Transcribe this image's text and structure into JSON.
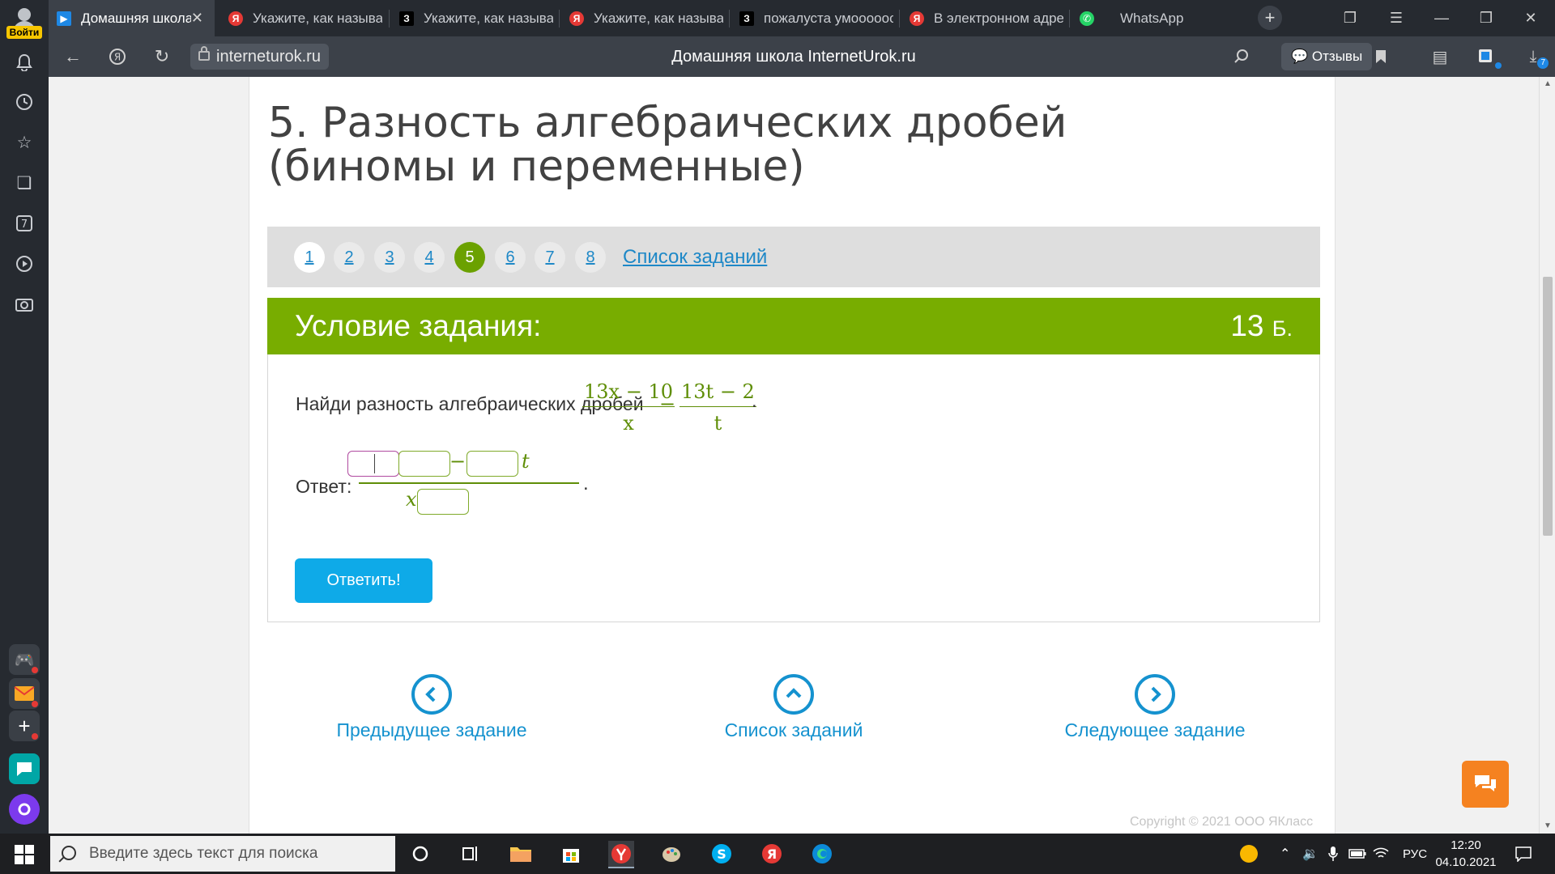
{
  "browser": {
    "tabs": [
      {
        "label": "Домашняя школа",
        "favicon": "home-icon",
        "active": true
      },
      {
        "label": "Укажите, как называ",
        "favicon": "yandex-icon"
      },
      {
        "label": "Укажите, как называ",
        "favicon": "znanija-icon"
      },
      {
        "label": "Укажите, как называ",
        "favicon": "yandex-icon"
      },
      {
        "label": "пожалуста умоооооо",
        "favicon": "znanija-icon"
      },
      {
        "label": "В электронном адре",
        "favicon": "yandex-icon"
      },
      {
        "label": "WhatsApp",
        "favicon": "whatsapp-icon"
      }
    ],
    "url": "interneturok.ru",
    "page_title": "Домашняя школа InternetUrok.ru",
    "reviews_label": "Отзывы",
    "downloads_badge": "7"
  },
  "sidebar": {
    "login_label": "Войти",
    "counter_badge": "7"
  },
  "page": {
    "title": "5. Разность алгебраических дробей (биномы и переменные)",
    "task_numbers": [
      "1",
      "2",
      "3",
      "4",
      "5",
      "6",
      "7",
      "8"
    ],
    "current_task": "5",
    "task_list_link": "Список заданий",
    "condition_title": "Условие задания:",
    "points_value": "13",
    "points_unit": "Б.",
    "question_text": "Найди разность алгебраических дробей",
    "fraction1_num": "13x − 10",
    "fraction1_den": "x",
    "fraction2_num": "13t − 2",
    "fraction2_den": "t",
    "minus_sign": "−",
    "period": ".",
    "answer_label": "Ответ:",
    "answer_num_var": "t",
    "answer_den_var": "x",
    "submit_label": "Ответить!",
    "prev_label": "Предыдущее задание",
    "list_label": "Список заданий",
    "next_label": "Следующее задание",
    "copyright": "Copyright © 2021 ООО ЯКласс"
  },
  "taskbar": {
    "search_placeholder": "Введите здесь текст для поиска",
    "language": "РУС",
    "time": "12:20",
    "date": "04.10.2021"
  },
  "colors": {
    "accent_green": "#78ad00",
    "link_blue": "#1e88c7",
    "button_blue": "#0eaae8",
    "chat_orange": "#f58220"
  }
}
